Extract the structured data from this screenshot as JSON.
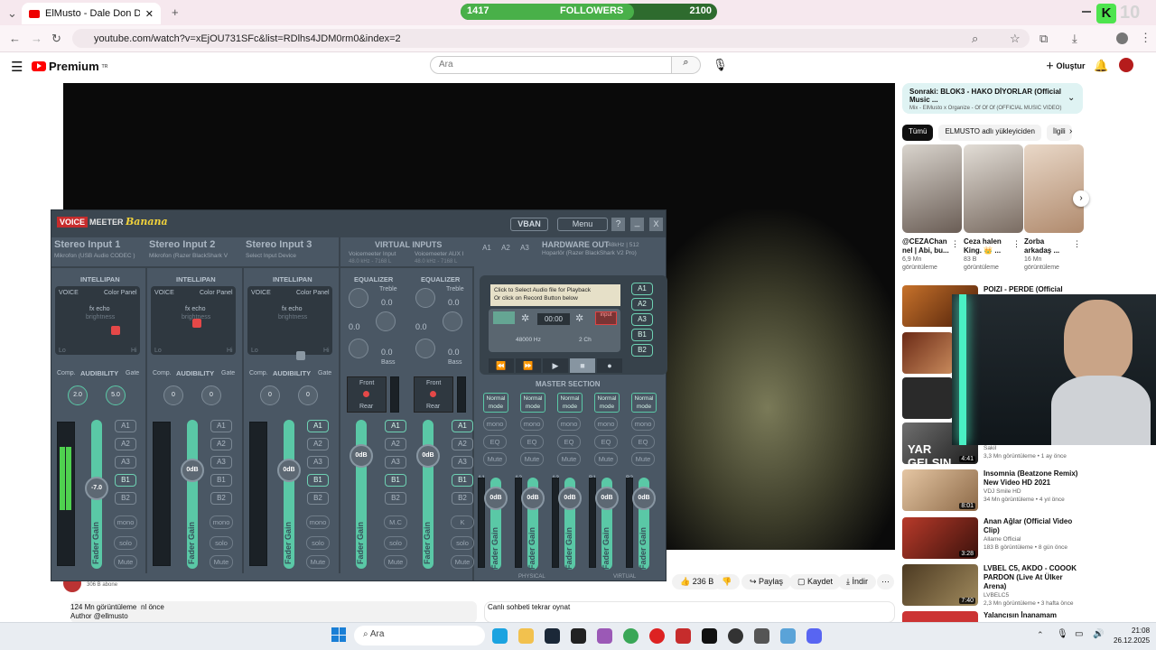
{
  "browser": {
    "tab_title": "ElMusto - Dale Don Dale (Offici…",
    "url": "youtube.com/watch?v=xEjOU731SFc&list=RDlhs4JDM0rm0&index=2"
  },
  "followers": {
    "current": "1417",
    "label": "FOLLOWERS",
    "goal": "2100",
    "progress": 0.675,
    "badge": "10"
  },
  "youtube": {
    "logo": "Premium",
    "logo_sup": "TR",
    "search_placeholder": "Ara",
    "create_label": "Oluştur",
    "like_count": "236 B",
    "share_label": "Paylaş",
    "save_label": "Kaydet",
    "download_label": "İndir",
    "subs": "306 B abone",
    "views": "124 Mn görüntüleme",
    "ago": "nl önce",
    "author": "Author @ellmusto",
    "live_chat": "Canlı sohbeti tekrar oynat",
    "colors": {
      "accent": "#ff0000"
    }
  },
  "sidebar": {
    "up_next_title": "Sonraki: BLOK3 - HAKO DİYORLAR (Official Music ...",
    "up_next_sub": "Mix - ElMusto x Organize - Of Of Of (OFFICIAL MUSIC VIDEO)",
    "chips": [
      "Tümü",
      "ELMUSTO adlı yükleyiciden",
      "İlgili"
    ],
    "shorts": [
      {
        "title": "@CEZAChan nel | Abi, bu...",
        "views": "6,9 Mn görüntüleme"
      },
      {
        "title": "Ceza halen King. 👑 ...",
        "views": "83 B görüntüleme"
      },
      {
        "title": "Zorba arkadaş ...",
        "views": "16 Mn görüntüleme"
      }
    ],
    "videos": [
      {
        "title": "POIZI - PERDE (Official Video)",
        "channel": "",
        "meta": "",
        "duration": ""
      },
      {
        "title": "",
        "channel": "Sakil",
        "meta": "3,3 Mn görüntüleme • 1 ay önce",
        "duration": "4:41",
        "thumb_text": "YAR GELSIN"
      },
      {
        "title": "Insomnia (Beatzone Remix) New Video HD 2021",
        "channel": "VDJ Smile HD",
        "meta": "34 Mn görüntüleme • 4 yıl önce",
        "duration": "8:01"
      },
      {
        "title": "Anan Ağlar (Official Video Clip)",
        "channel": "Allame Official",
        "meta": "183 B görüntüleme • 8 gün önce",
        "duration": "3:28"
      },
      {
        "title": "LVBEL C5, AKDO - COOOK PARDON (Live At Ülker Arena)",
        "channel": "LVBELC5",
        "meta": "2,3 Mn görüntüleme • 3 hafta önce",
        "duration": "7:40"
      },
      {
        "title": "Yalancısın İnanamam",
        "channel": "",
        "meta": "",
        "duration": ""
      }
    ]
  },
  "voicemeeter": {
    "brand_voice": "VOICE",
    "brand_meeter": "MEETER",
    "brand_banana": "Banana",
    "vban": "VBAN",
    "menu": "Menu",
    "help": "?",
    "minimize": "_",
    "close": "X",
    "inputs": [
      {
        "title": "Stereo Input 1",
        "device": "Mikrofon (USB Audio CODEC )",
        "gain": "-7.0",
        "comp": "2.0",
        "gate": "5.0",
        "fader_pct": 0.62
      },
      {
        "title": "Stereo Input 2",
        "device": "Mikrofon (Razer BlackShark V",
        "gain": "0dB",
        "comp": "0",
        "gate": "0",
        "fader_pct": 0.74
      },
      {
        "title": "Stereo Input 3",
        "device": "Select Input Device",
        "gain": "0dB",
        "comp": "0",
        "gate": "0",
        "fader_pct": 0.74
      }
    ],
    "virtual_inputs": {
      "title": "VIRTUAL INPUTS",
      "devices": [
        "Voicemeeter Input",
        "Voicemeeter AUX I"
      ],
      "rates": [
        "48.0 kHz - 7168 L",
        "48.0 kHz - 7168 L"
      ],
      "gains": [
        "0dB",
        "0dB"
      ],
      "extra": [
        "M.C",
        "K"
      ]
    },
    "hardware_out": {
      "title": "HARDWARE OUT",
      "rate": "48kHz | 512",
      "device": "Hoparlör (Razer BlackShark V2 Pro)"
    },
    "labels": {
      "intellipan": "INTELLIPAN",
      "voice": "VOICE",
      "color_panel": "Color Panel",
      "fx_echo": "fx echo",
      "brightness": "brightness",
      "lo": "Lo",
      "hi": "Hi",
      "comp": "Comp.",
      "audibility": "AUDIBILITY",
      "gate": "Gate",
      "equalizer": "EQUALIZER",
      "treble": "Treble",
      "bass": "Bass",
      "front": "Front",
      "rear": "Rear",
      "fader_gain": "Fader Gain",
      "mono": "mono",
      "solo": "solo",
      "mute": "Mute",
      "eq": "EQ",
      "master_section": "MASTER SECTION",
      "normal_mode": "Normal mode",
      "physical": "PHYSICAL",
      "virtual": "VIRTUAL",
      "eq_val": "0.0"
    },
    "buses": [
      "A1",
      "A2",
      "A3",
      "B1",
      "B2"
    ],
    "player": {
      "line1": "Click to Select Audio file for Playback",
      "line2": "Or click on Record Button below",
      "time": "00:00",
      "rate": "48000 Hz",
      "channels": "2 Ch",
      "input": "input"
    },
    "master": [
      {
        "bus": "A1",
        "gain": "0dB"
      },
      {
        "bus": "A2",
        "gain": "0dB"
      },
      {
        "bus": "A3",
        "gain": "0dB"
      },
      {
        "bus": "B1",
        "gain": "0dB"
      },
      {
        "bus": "B2",
        "gain": "0dB"
      }
    ]
  },
  "taskbar": {
    "search": "Ara",
    "time": "21:08",
    "date": "26.12.2025"
  }
}
